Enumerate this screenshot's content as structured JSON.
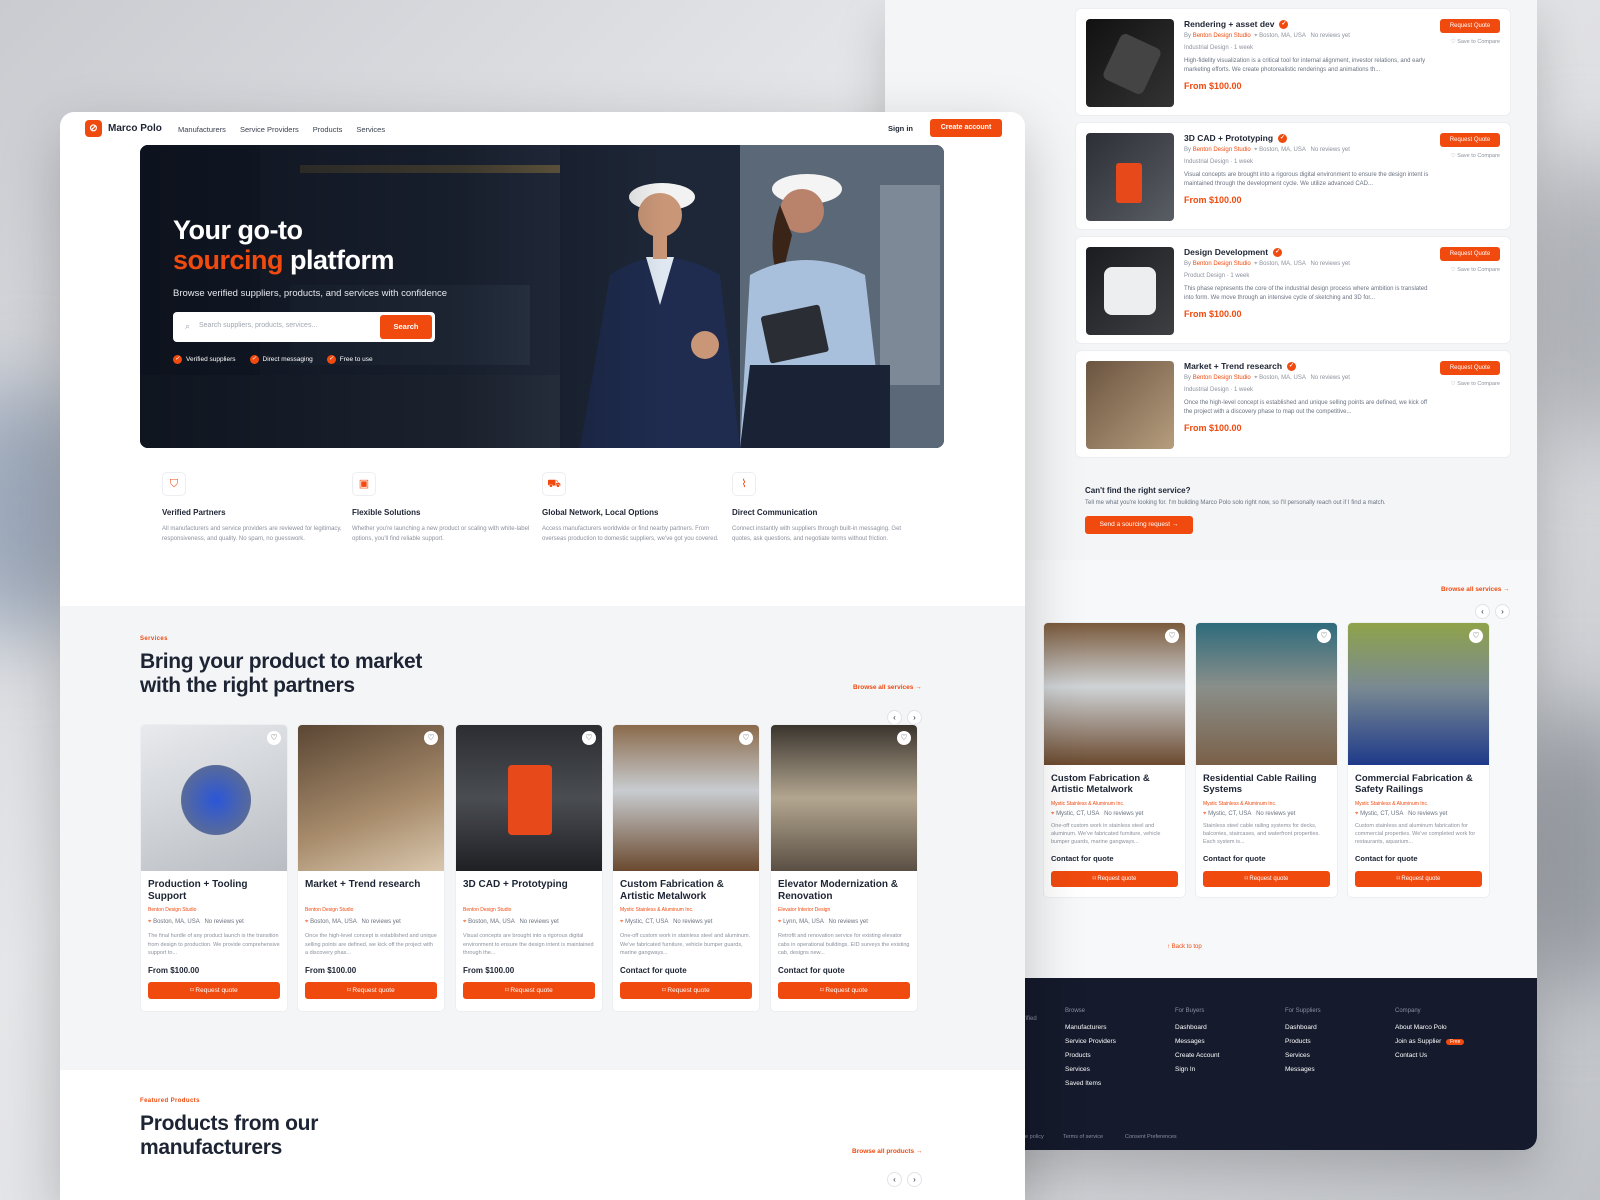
{
  "brand": {
    "name": "Marco Polo",
    "accent": "#f04a0f",
    "dark": "#151a2c"
  },
  "nav": {
    "links": [
      "Manufacturers",
      "Service Providers",
      "Products",
      "Services"
    ],
    "signin": "Sign in",
    "create": "Create account"
  },
  "hero": {
    "title_line1": "Your go-to",
    "title_accent": "sourcing",
    "title_rest": "platform",
    "subtitle": "Browse verified suppliers, products, and services with confidence",
    "search_placeholder": "Search suppliers, products, services...",
    "search_button": "Search",
    "badges": [
      "Verified suppliers",
      "Direct messaging",
      "Free to use"
    ]
  },
  "features": [
    {
      "icon": "shield-icon",
      "title": "Verified Partners",
      "desc": "All manufacturers and service providers are reviewed for legitimacy, responsiveness, and quality. No spam, no guesswork."
    },
    {
      "icon": "box-icon",
      "title": "Flexible Solutions",
      "desc": "Whether you're launching a new product or scaling with white-label options, you'll find reliable support."
    },
    {
      "icon": "truck-icon",
      "title": "Global Network, Local Options",
      "desc": "Access manufacturers worldwide or find nearby partners. From overseas production to domestic suppliers, we've got you covered."
    },
    {
      "icon": "activity-icon",
      "title": "Direct Communication",
      "desc": "Connect instantly with suppliers through built-in messaging. Get quotes, ask questions, and negotiate terms without friction."
    }
  ],
  "services_section": {
    "eyebrow": "Services",
    "heading_line1": "Bring your product to market",
    "heading_line2": "with the right partners",
    "browse": "Browse all services →"
  },
  "service_cards": [
    {
      "title": "Production + Tooling Support",
      "supplier": "Benton Design Studio",
      "location": "Boston, MA, USA",
      "reviews": "No reviews yet",
      "desc": "The final hurdle of any product launch is the transition from design to production. We provide comprehensive support to...",
      "price": "From $100.00",
      "button": "Request quote"
    },
    {
      "title": "Market + Trend research",
      "supplier": "Benton Design Studio",
      "location": "Boston, MA, USA",
      "reviews": "No reviews yet",
      "desc": "Once the high-level concept is established and unique selling points are defined, we kick off the project with a discovery phas...",
      "price": "From $100.00",
      "button": "Request quote"
    },
    {
      "title": "3D CAD + Prototyping",
      "supplier": "Benton Design Studio",
      "location": "Boston, MA, USA",
      "reviews": "No reviews yet",
      "desc": "Visual concepts are brought into a rigorous digital environment to ensure the design intent is maintained through the...",
      "price": "From $100.00",
      "button": "Request quote"
    },
    {
      "title": "Custom Fabrication & Artistic Metalwork",
      "supplier": "Mystic Stainless & Aluminum Inc.",
      "location": "Mystic, CT, USA",
      "reviews": "No reviews yet",
      "desc": "One-off custom work in stainless steel and aluminum. We've fabricated furniture, vehicle bumper guards, marine gangways...",
      "price": "Contact for quote",
      "button": "Request quote"
    },
    {
      "title": "Elevator Modernization & Renovation",
      "supplier": "Elevator Interior Design",
      "location": "Lynn, MA, USA",
      "reviews": "No reviews yet",
      "desc": "Retrofit and renovation service for existing elevator cabs in operational buildings. EID surveys the existing cab, designs new...",
      "price": "Contact for quote",
      "button": "Request quote"
    }
  ],
  "products_section": {
    "eyebrow": "Featured Products",
    "heading_line1": "Products from our",
    "heading_line2": "manufacturers",
    "browse": "Browse all products →"
  },
  "back_list": [
    {
      "title": "Rendering + asset dev",
      "by": "By",
      "studio": "Benton Design Studio",
      "location": "Boston, MA, USA",
      "reviews": "No reviews yet",
      "cat": "Industrial Design · 1 week",
      "desc": "High-fidelity visualization is a critical tool for internal alignment, investor relations, and early marketing efforts. We create photorealistic renderings and animations th...",
      "price": "From $100.00"
    },
    {
      "title": "3D CAD + Prototyping",
      "by": "By",
      "studio": "Benton Design Studio",
      "location": "Boston, MA, USA",
      "reviews": "No reviews yet",
      "cat": "Industrial Design · 1 week",
      "desc": "Visual concepts are brought into a rigorous digital environment to ensure the design intent is maintained through the development cycle. We utilize advanced CAD...",
      "price": "From $100.00"
    },
    {
      "title": "Design Development",
      "by": "By",
      "studio": "Benton Design Studio",
      "location": "Boston, MA, USA",
      "reviews": "No reviews yet",
      "cat": "Product Design · 1 week",
      "desc": "This phase represents the core of the industrial design process where ambition is translated into form. We move through an intensive cycle of sketching and 3D for...",
      "price": "From $100.00"
    },
    {
      "title": "Market + Trend research",
      "by": "By",
      "studio": "Benton Design Studio",
      "location": "Boston, MA, USA",
      "reviews": "No reviews yet",
      "cat": "Industrial Design · 1 week",
      "desc": "Once the high-level concept is established and unique selling points are defined, we kick off the project with a discovery phase to map out the competitive...",
      "price": "From $100.00"
    }
  ],
  "back_actions": {
    "request": "Request Quote",
    "save": "Save to Compare"
  },
  "cant_find": {
    "title": "Can't find the right service?",
    "text": "Tell me what you're looking for. I'm building Marco Polo solo right now, so I'll personally reach out if I find a match.",
    "button": "Send a sourcing request →"
  },
  "back_services": {
    "browse": "Browse all services →",
    "cards": [
      {
        "title": "Custom Fabrication & Artistic Metalwork",
        "supplier": "Mystic Stainless & Aluminum Inc.",
        "location": "Mystic, CT, USA",
        "reviews": "No reviews yet",
        "desc": "One-off custom work in stainless steel and aluminum. We've fabricated furniture, vehicle bumper guards, marine gangways...",
        "price": "Contact for quote",
        "button": "Request quote"
      },
      {
        "title": "Residential Cable Railing Systems",
        "supplier": "Mystic Stainless & Aluminum Inc.",
        "location": "Mystic, CT, USA",
        "reviews": "No reviews yet",
        "desc": "Stainless steel cable railing systems for decks, balconies, staircases, and waterfront properties. Each system is...",
        "price": "Contact for quote",
        "button": "Request quote"
      },
      {
        "title": "Commercial Fabrication & Safety Railings",
        "supplier": "Mystic Stainless & Aluminum Inc.",
        "location": "Mystic, CT, USA",
        "reviews": "No reviews yet",
        "desc": "Custom stainless and aluminum fabrication for commercial properties. We've completed work for restaurants, aquarium...",
        "price": "Contact for quote",
        "button": "Request quote"
      }
    ],
    "back_to_top": "Back to top"
  },
  "footer": {
    "cols": [
      {
        "head": "Browse",
        "items": [
          "Manufacturers",
          "Service Providers",
          "Products",
          "Services",
          "Saved Items"
        ]
      },
      {
        "head": "For Buyers",
        "items": [
          "Dashboard",
          "Messages",
          "Create Account",
          "Sign In"
        ]
      },
      {
        "head": "For Suppliers",
        "items": [
          "Dashboard",
          "Products",
          "Services",
          "Messages"
        ]
      },
      {
        "head": "Company",
        "items": [
          "About Marco Polo",
          "Join as Supplier",
          "Contact Us"
        ]
      }
    ],
    "free_tag": "Free",
    "partial_left": "with verified",
    "bottom": [
      "Cookie policy",
      "Terms of service",
      "Consent Preferences"
    ]
  }
}
